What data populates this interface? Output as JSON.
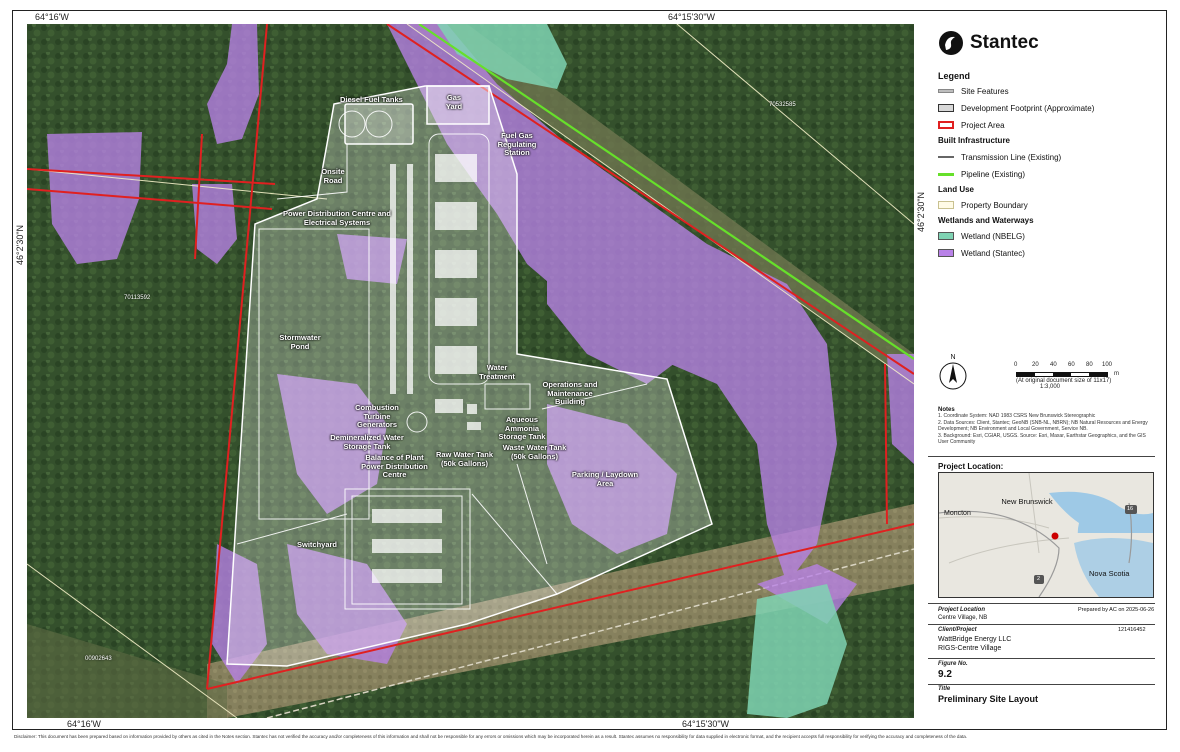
{
  "coords": {
    "top_left": "64°16'W",
    "top_center": "64°15'30\"W",
    "bottom_left": "64°16'W",
    "bottom_center": "64°15'30\"W",
    "left_side": "46°2'30\"N",
    "right_side": "46°2'30\"N"
  },
  "map_labels": {
    "diesel": "Diesel Fuel Tanks",
    "gas_yard": "Gas Yard",
    "fuel_gas": "Fuel Gas Regulating Station",
    "onsite_road": "Onsite Road",
    "pdc": "Power Distribution Centre and Electrical Systems",
    "ctg": "Combustion Turbine Generators",
    "stormwater": "Stormwater Pond",
    "water_treatment": "Water Treatment",
    "ops": "Operations and Maintenance Building",
    "demin": "Demineralized Water Storage Tank",
    "ammonia": "Aqueous Ammonia Storage Tank",
    "bop": "Balance of Plant Power Distribution Centre",
    "raw_water": "Raw Water Tank (50k Gallons)",
    "waste_water": "Waste Water Tank (50k Gallons)",
    "parking": "Parking / Laydown Area",
    "switchyard": "Switchyard"
  },
  "parcels": {
    "p1": "70532585",
    "p2": "70113592",
    "p3": "00902643"
  },
  "panel": {
    "logo_text": "Stantec",
    "legend_title": "Legend",
    "legend_items": {
      "site_features": "Site Features",
      "dev_footprint": "Development Footprint (Approximate)",
      "project_area": "Project Area",
      "built_infra": "Built Infrastructure",
      "transmission": "Transmission Line (Existing)",
      "pipeline": "Pipeline (Existing)",
      "land_use": "Land Use",
      "property": "Property Boundary",
      "wetlands_h": "Wetlands and Waterways",
      "wetland_nbelg": "Wetland (NBELG)",
      "wetland_stantec": "Wetland (Stantec)"
    },
    "north": "N",
    "scale_ticks": [
      "0",
      "20",
      "40",
      "60",
      "80",
      "100"
    ],
    "scale_unit": "m",
    "scale_note": "(At original document size of 11x17)",
    "scale_ratio": "1:3,000",
    "notes_title": "Notes",
    "notes": [
      "1. Coordinate System: NAD 1983 CSRS New Brunswick Stereographic",
      "2. Data Sources: Client, Stantec; GeoNB (SNB-NL, NBRN); NB Natural Resources and Energy",
      "Development; NB Environment and Local Government, Service NB.",
      "3. Background: Esri, CGIAR, USGS. Source: Esri, Maxar, Earthstar Geographics, and the GIS",
      "User Community"
    ],
    "project_location_title": "Project Location:",
    "inset": {
      "moncton": "Moncton",
      "new_brunswick": "New Brunswick",
      "nova_scotia": "Nova Scotia",
      "hwy16": "16",
      "hwy2": "2"
    },
    "project_location_label": "Project Location",
    "project_location_value": "Centre Village, NB",
    "prepared_by": "Prepared by AC on 2025-06-26",
    "client_label": "Client/Project",
    "project_number": "121416452",
    "client_value": "WattBridge Energy LLC",
    "project_value": "RIGS-Centre Village",
    "figure_label": "Figure No.",
    "figure_value": "9.2",
    "title_label": "Title",
    "title_value": "Preliminary Site Layout"
  },
  "disclaimer": "Disclaimer: This document has been prepared based on information provided by others as cited in the Notes section. Stantec has not verified the accuracy and/or completeness of this information and shall not be responsible for any errors or omissions which may be incorporated herein as a result. Stantec assumes no responsibility for data supplied in electronic format, and the recipient accepts full responsibility for verifying the accuracy and completeness of the data.",
  "colors": {
    "project_area": "#e02020",
    "wetland_stantec": "#b982e8",
    "wetland_nbelg": "#7fd3b3",
    "pipeline": "#66e02a",
    "site_features": "#bdbdbd",
    "property": "#f4f0c8"
  }
}
